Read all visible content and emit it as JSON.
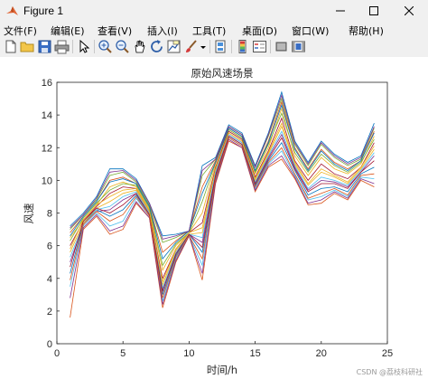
{
  "window": {
    "title": "Figure 1",
    "buttons": [
      "minimize",
      "maximize",
      "close"
    ]
  },
  "menubar": {
    "items": [
      "文件(F)",
      "编辑(E)",
      "查看(V)",
      "插入(I)",
      "工具(T)",
      "桌面(D)",
      "窗口(W)",
      "帮助(H)"
    ]
  },
  "toolbar": {
    "icons": [
      "new-figure-icon",
      "open-icon",
      "save-icon",
      "print-icon",
      "pointer-icon",
      "zoom-in-icon",
      "zoom-out-icon",
      "pan-icon",
      "rotate-icon",
      "data-cursor-icon",
      "brush-icon",
      "brush-dropdown-icon",
      "link-icon",
      "colorbar-icon",
      "legend-icon",
      "hide-plot-tools-icon",
      "show-plot-tools-icon"
    ]
  },
  "chart_data": {
    "type": "line",
    "title": "原始风速场景",
    "xlabel": "时间/h",
    "ylabel": "风速",
    "xlim": [
      0,
      25
    ],
    "ylim": [
      0,
      16
    ],
    "xticks": [
      0,
      5,
      10,
      15,
      20,
      25
    ],
    "yticks": [
      0,
      2,
      4,
      6,
      8,
      10,
      12,
      14,
      16
    ],
    "grid": false,
    "legend": "none",
    "x": [
      1,
      2,
      3,
      4,
      5,
      6,
      7,
      8,
      9,
      10,
      11,
      12,
      13,
      14,
      15,
      16,
      17,
      18,
      19,
      20,
      21,
      22,
      23,
      24
    ],
    "series": [
      {
        "values": [
          7.2,
          8.0,
          9.0,
          10.7,
          10.7,
          10.1,
          8.6,
          6.6,
          6.7,
          6.9,
          10.9,
          11.4,
          13.4,
          12.9,
          10.9,
          12.9,
          15.4,
          12.4,
          11.1,
          12.4,
          11.6,
          11.1,
          11.5,
          13.5
        ]
      },
      {
        "values": [
          1.6,
          7.0,
          7.8,
          6.7,
          7.0,
          8.6,
          7.7,
          2.2,
          5.0,
          6.6,
          3.9,
          9.8,
          12.4,
          12.0,
          9.3,
          10.8,
          11.3,
          10.1,
          8.5,
          8.6,
          9.2,
          8.8,
          10.0,
          9.6
        ]
      },
      {
        "values": [
          6.5,
          7.6,
          8.5,
          9.6,
          9.9,
          9.6,
          8.2,
          4.5,
          6.0,
          6.8,
          8.0,
          11.0,
          13.1,
          12.6,
          10.4,
          12.0,
          14.4,
          11.5,
          10.3,
          11.4,
          10.7,
          10.4,
          11.0,
          12.7
        ]
      },
      {
        "values": [
          5.0,
          7.3,
          8.1,
          8.2,
          8.8,
          9.2,
          7.9,
          3.3,
          5.5,
          6.7,
          6.2,
          10.4,
          12.8,
          12.3,
          9.8,
          11.4,
          12.8,
          10.8,
          9.4,
          10.0,
          9.9,
          9.6,
          10.5,
          11.5
        ]
      },
      {
        "values": [
          7.0,
          7.9,
          8.8,
          10.3,
          10.5,
          9.9,
          8.5,
          6.2,
          6.5,
          6.9,
          10.3,
          11.3,
          13.3,
          12.8,
          10.8,
          12.7,
          15.0,
          12.2,
          10.9,
          12.2,
          11.4,
          10.9,
          11.3,
          13.2
        ]
      },
      {
        "values": [
          3.5,
          7.2,
          8.0,
          7.2,
          7.5,
          8.9,
          7.8,
          2.6,
          5.2,
          6.6,
          4.8,
          10.0,
          12.6,
          12.1,
          9.5,
          11.0,
          11.8,
          10.3,
          8.8,
          9.0,
          9.4,
          9.0,
          10.2,
          10.1
        ]
      },
      {
        "values": [
          6.0,
          7.5,
          8.4,
          9.2,
          9.6,
          9.5,
          8.1,
          4.0,
          5.8,
          6.8,
          7.4,
          10.8,
          13.0,
          12.5,
          10.2,
          11.8,
          13.8,
          11.2,
          10.0,
          11.0,
          10.4,
          10.1,
          10.8,
          12.3
        ]
      },
      {
        "values": [
          4.3,
          7.4,
          8.2,
          7.8,
          8.2,
          9.1,
          7.9,
          3.0,
          5.4,
          6.7,
          5.6,
          10.2,
          12.7,
          12.2,
          9.7,
          11.2,
          12.3,
          10.6,
          9.1,
          9.5,
          9.6,
          9.3,
          10.4,
          10.8
        ]
      },
      {
        "values": [
          6.8,
          7.8,
          8.7,
          10.0,
          10.2,
          9.8,
          8.4,
          5.6,
          6.3,
          6.9,
          9.6,
          11.2,
          13.2,
          12.7,
          10.6,
          12.4,
          14.8,
          12.0,
          10.7,
          11.9,
          11.1,
          10.7,
          11.2,
          13.0
        ]
      },
      {
        "values": [
          5.6,
          7.4,
          8.3,
          8.7,
          9.2,
          9.4,
          8.0,
          3.6,
          5.7,
          6.7,
          6.8,
          10.6,
          12.9,
          12.4,
          10.0,
          11.6,
          13.3,
          11.0,
          9.7,
          10.5,
          10.2,
          9.8,
          10.7,
          11.9
        ]
      },
      {
        "values": [
          2.8,
          7.1,
          7.9,
          6.9,
          7.2,
          8.7,
          7.7,
          2.4,
          5.1,
          6.6,
          4.3,
          9.9,
          12.5,
          12.0,
          9.4,
          10.9,
          11.5,
          10.2,
          8.6,
          8.8,
          9.3,
          8.9,
          10.1,
          9.8
        ]
      },
      {
        "values": [
          6.3,
          7.7,
          8.6,
          9.4,
          9.8,
          9.7,
          8.3,
          4.8,
          6.1,
          6.8,
          8.7,
          11.1,
          13.1,
          12.6,
          10.5,
          12.2,
          14.1,
          11.7,
          10.5,
          11.6,
          10.9,
          10.5,
          11.1,
          12.5
        ]
      },
      {
        "values": [
          5.3,
          7.3,
          8.2,
          8.4,
          9.0,
          9.3,
          8.0,
          3.4,
          5.6,
          6.7,
          6.5,
          10.5,
          12.8,
          12.3,
          9.9,
          11.5,
          13.0,
          10.9,
          9.5,
          10.2,
          10.0,
          9.7,
          10.6,
          11.7
        ]
      },
      {
        "values": [
          4.7,
          7.5,
          8.3,
          8.0,
          8.5,
          9.2,
          7.9,
          3.2,
          5.5,
          6.7,
          5.9,
          10.3,
          12.7,
          12.2,
          9.8,
          11.3,
          12.6,
          10.7,
          9.3,
          9.8,
          9.8,
          9.5,
          10.5,
          11.2
        ]
      },
      {
        "values": [
          6.6,
          7.8,
          8.7,
          9.9,
          10.1,
          9.8,
          8.4,
          5.2,
          6.2,
          6.9,
          9.2,
          11.1,
          13.2,
          12.7,
          10.6,
          12.3,
          14.6,
          11.9,
          10.6,
          11.8,
          11.0,
          10.6,
          11.2,
          12.9
        ]
      },
      {
        "values": [
          3.9,
          7.3,
          8.1,
          7.5,
          7.9,
          9.0,
          7.8,
          2.8,
          5.3,
          6.6,
          5.2,
          10.1,
          12.6,
          12.1,
          9.6,
          11.1,
          12.0,
          10.4,
          8.9,
          9.2,
          9.5,
          9.1,
          10.3,
          10.4
        ]
      },
      {
        "values": [
          5.8,
          7.6,
          8.5,
          9.0,
          9.4,
          9.5,
          8.1,
          3.8,
          5.8,
          6.8,
          7.1,
          10.7,
          12.9,
          12.4,
          10.1,
          11.7,
          13.5,
          11.1,
          9.8,
          10.7,
          10.3,
          9.9,
          10.8,
          12.1
        ]
      },
      {
        "values": [
          7.1,
          7.9,
          8.9,
          10.5,
          10.6,
          10.0,
          8.6,
          6.4,
          6.6,
          6.9,
          10.6,
          11.3,
          13.3,
          12.8,
          10.8,
          12.8,
          15.2,
          12.3,
          11.0,
          12.3,
          11.5,
          11.0,
          11.4,
          13.3
        ]
      }
    ]
  },
  "watermark": "CSDN @荔枝科研社"
}
